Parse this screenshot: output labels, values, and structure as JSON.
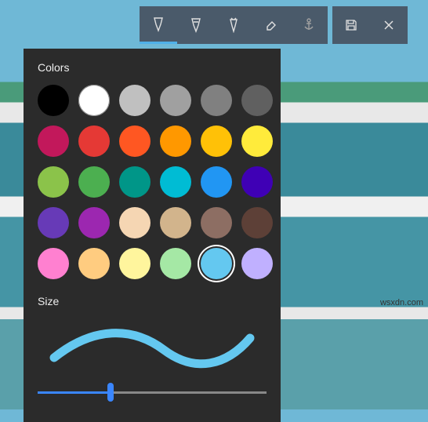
{
  "toolbar": {
    "tools": [
      {
        "name": "ballpoint-pen",
        "active": true
      },
      {
        "name": "pencil",
        "active": false
      },
      {
        "name": "highlighter",
        "active": false
      },
      {
        "name": "eraser",
        "active": false
      },
      {
        "name": "anchor",
        "active": false
      }
    ],
    "actions": [
      {
        "name": "save"
      },
      {
        "name": "close"
      }
    ]
  },
  "panel": {
    "colors_label": "Colors",
    "size_label": "Size",
    "colors": [
      "#000000",
      "#ffffff",
      "#c0c0c0",
      "#a0a0a0",
      "#808080",
      "#606060",
      "#c2185b",
      "#e53935",
      "#ff5722",
      "#ff9800",
      "#ffc107",
      "#ffeb3b",
      "#8bc34a",
      "#4caf50",
      "#009688",
      "#00bcd4",
      "#2196f3",
      "#3f00b5",
      "#673ab7",
      "#9c27b0",
      "#f5d6b3",
      "#d2b48c",
      "#8d6e63",
      "#5d4037",
      "#ff80d0",
      "#ffcc80",
      "#fff59d",
      "#a5e8a5",
      "#64c8f0",
      "#c0b0ff"
    ],
    "selected_color_index": 28,
    "selected_color": "#64c8f0",
    "size_slider": {
      "value": 32,
      "min": 0,
      "max": 100
    }
  },
  "watermark": "wsxdn.com"
}
